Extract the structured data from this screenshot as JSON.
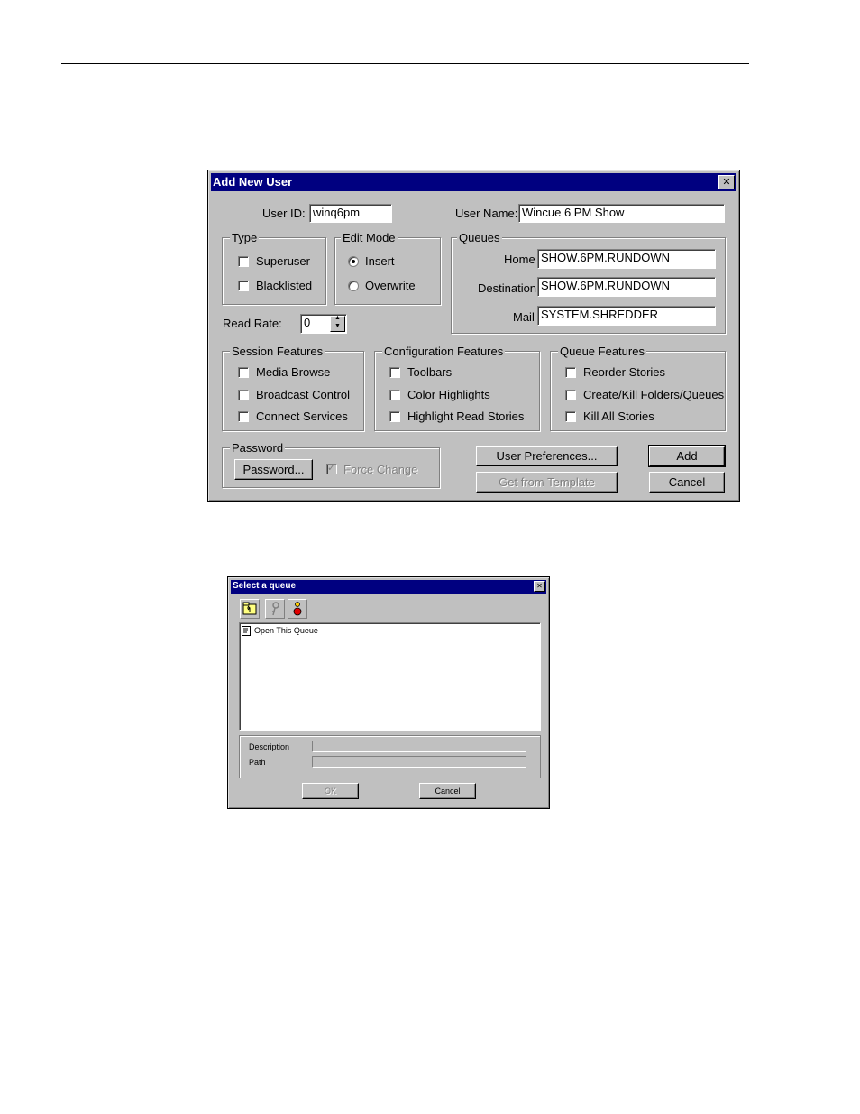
{
  "add_user_dialog": {
    "title": "Add New User",
    "user_id_label": "User ID:",
    "user_id_value": "winq6pm",
    "user_name_label": "User Name:",
    "user_name_value": "Wincue 6 PM Show",
    "type_group": {
      "title": "Type",
      "superuser": "Superuser",
      "blacklisted": "Blacklisted"
    },
    "edit_mode_group": {
      "title": "Edit Mode",
      "insert": "Insert",
      "overwrite": "Overwrite",
      "selected": "Insert"
    },
    "queues_group": {
      "title": "Queues",
      "home_label": "Home",
      "home_value": "SHOW.6PM.RUNDOWN",
      "destination_label": "Destination",
      "destination_value": "SHOW.6PM.RUNDOWN",
      "mail_label": "Mail",
      "mail_value": "SYSTEM.SHREDDER"
    },
    "read_rate_label": "Read Rate:",
    "read_rate_value": "0",
    "session_features": {
      "title": "Session Features",
      "items": [
        "Media Browse",
        "Broadcast Control",
        "Connect Services"
      ]
    },
    "configuration_features": {
      "title": "Configuration Features",
      "items": [
        "Toolbars",
        "Color Highlights",
        "Highlight Read Stories"
      ]
    },
    "queue_features": {
      "title": "Queue Features",
      "items": [
        "Reorder Stories",
        "Create/Kill Folders/Queues",
        "Kill All Stories"
      ]
    },
    "password_group": {
      "title": "Password",
      "password_button": "Password...",
      "force_change": "Force Change"
    },
    "user_preferences_button": "User Preferences...",
    "get_from_template_button": "Get from Template",
    "add_button": "Add",
    "cancel_button": "Cancel"
  },
  "select_queue_dialog": {
    "title": "Select a queue",
    "toolbar_icons": [
      "folder-up-icon",
      "key-icon",
      "person-icon"
    ],
    "list_items": [
      "Open This Queue"
    ],
    "description_label": "Description",
    "path_label": "Path",
    "ok_button": "OK",
    "cancel_button": "Cancel"
  }
}
